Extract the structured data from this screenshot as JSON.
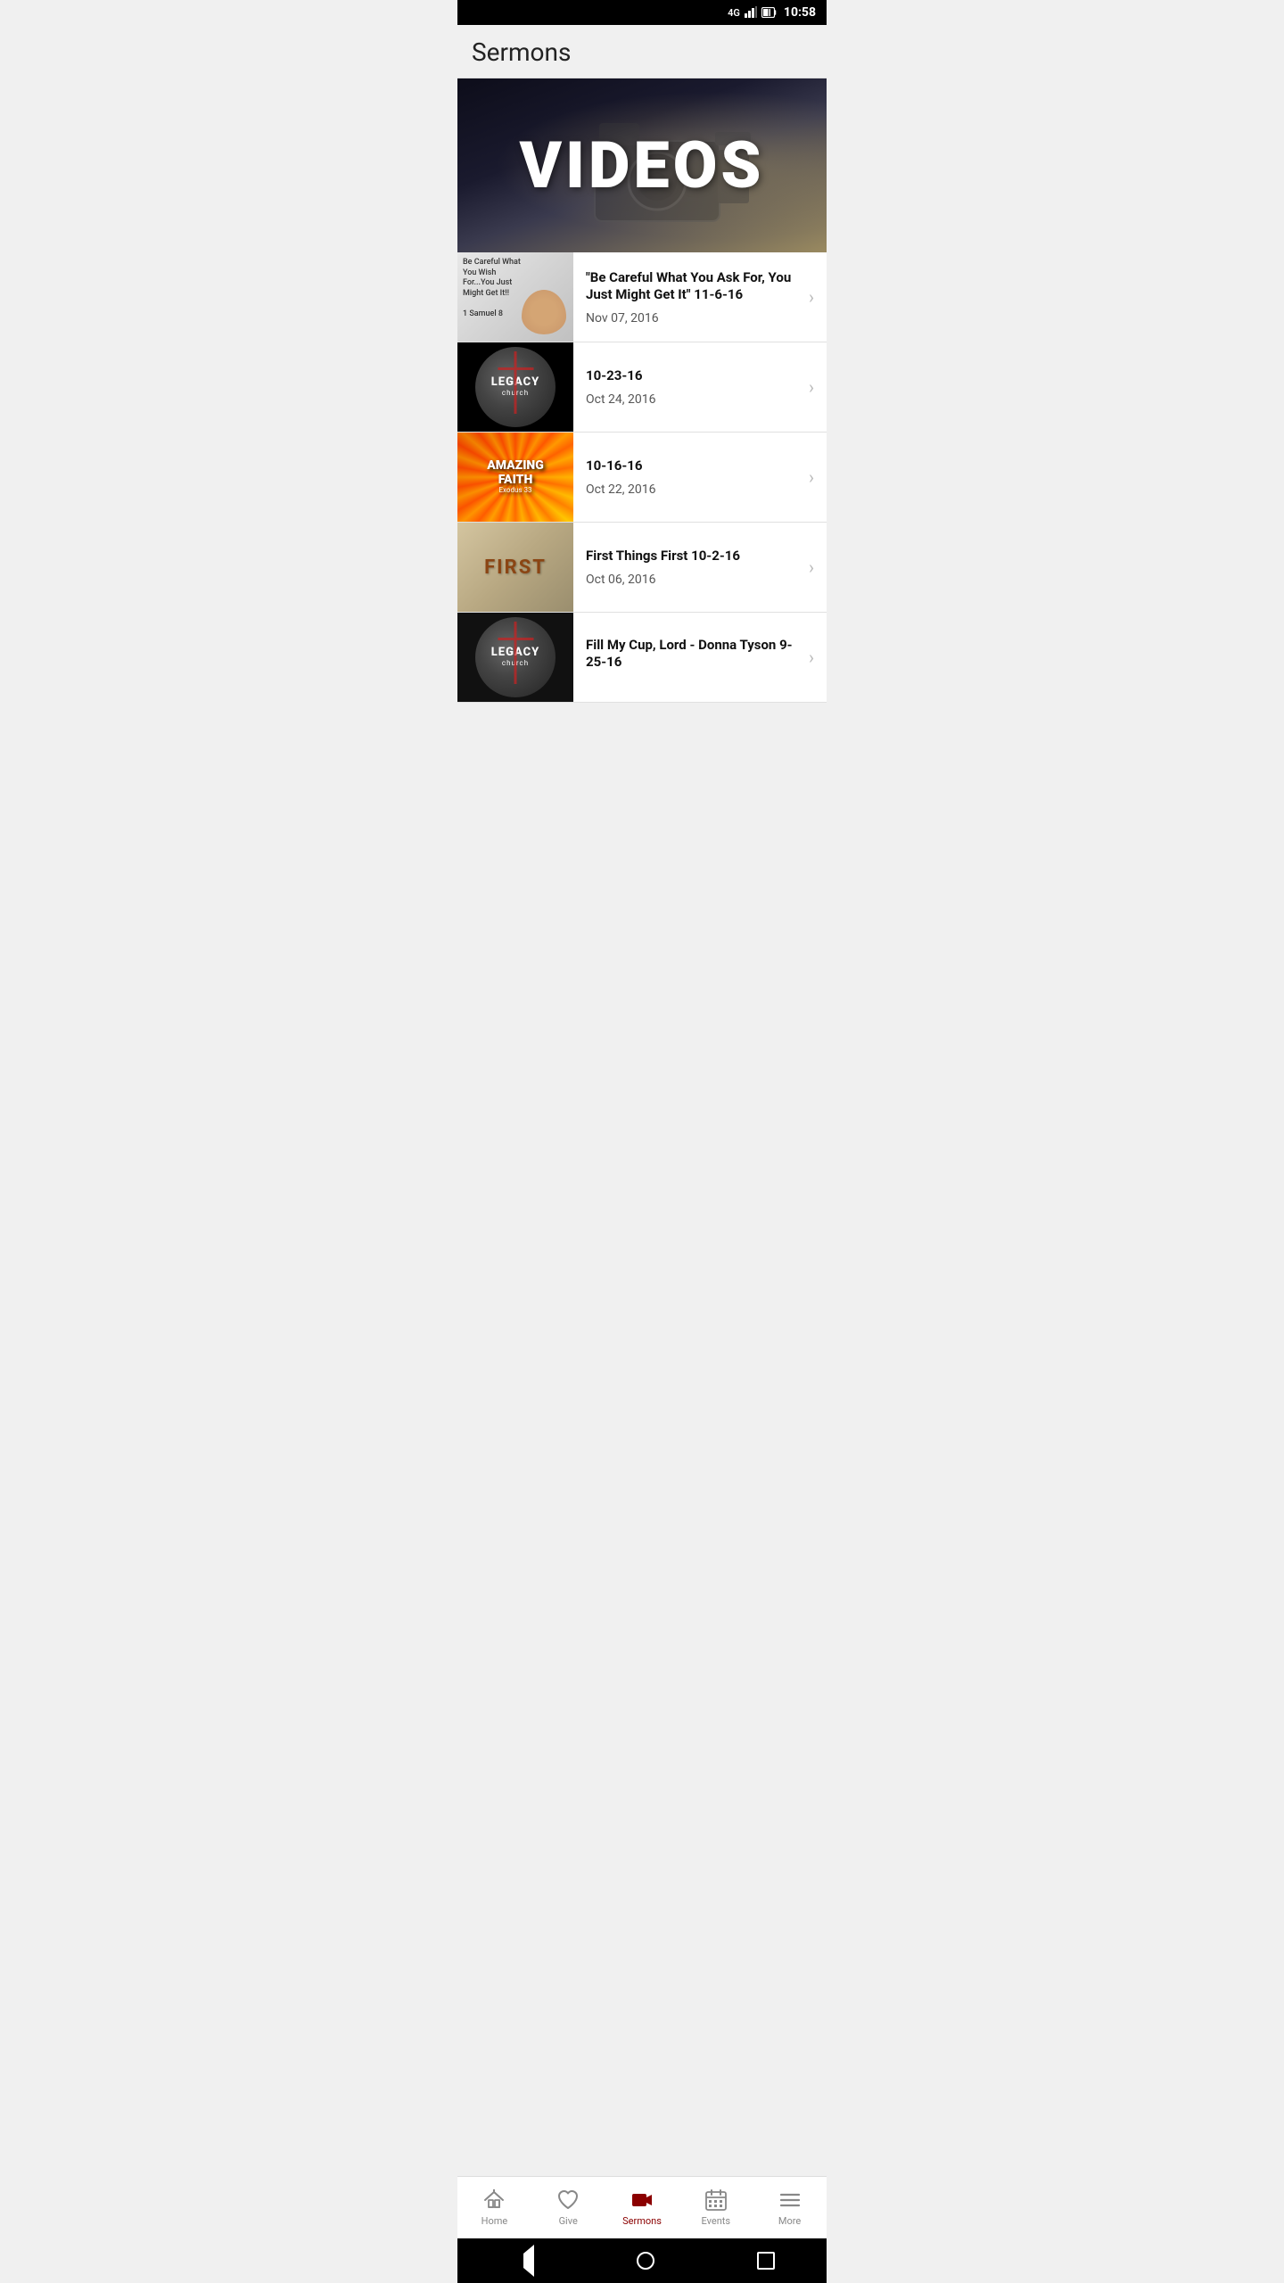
{
  "statusBar": {
    "signal": "4G",
    "time": "10:58",
    "batteryIcon": "🔋"
  },
  "header": {
    "title": "Sermons"
  },
  "hero": {
    "text": "VIDEOS"
  },
  "sermons": [
    {
      "id": 1,
      "title": "\"Be Careful What You Ask For, You Just Might Get It\"    11-6-16",
      "date": "Nov 07, 2016",
      "thumbType": "be-careful"
    },
    {
      "id": 2,
      "title": "10-23-16",
      "date": "Oct 24, 2016",
      "thumbType": "legacy"
    },
    {
      "id": 3,
      "title": "10-16-16",
      "date": "Oct 22, 2016",
      "thumbType": "amazing-faith"
    },
    {
      "id": 4,
      "title": "First Things First 10-2-16",
      "date": "Oct 06, 2016",
      "thumbType": "first"
    },
    {
      "id": 5,
      "title": "Fill My Cup, Lord - Donna Tyson 9-25-16",
      "date": "",
      "thumbType": "legacy"
    }
  ],
  "bottomNav": {
    "items": [
      {
        "id": "home",
        "label": "Home",
        "icon": "home",
        "active": false
      },
      {
        "id": "give",
        "label": "Give",
        "icon": "heart",
        "active": false
      },
      {
        "id": "sermons",
        "label": "Sermons",
        "icon": "video",
        "active": true
      },
      {
        "id": "events",
        "label": "Events",
        "icon": "calendar",
        "active": false
      },
      {
        "id": "more",
        "label": "More",
        "icon": "menu",
        "active": false
      }
    ]
  },
  "androidNav": {
    "back": "◀",
    "home": "●",
    "recents": "■"
  }
}
